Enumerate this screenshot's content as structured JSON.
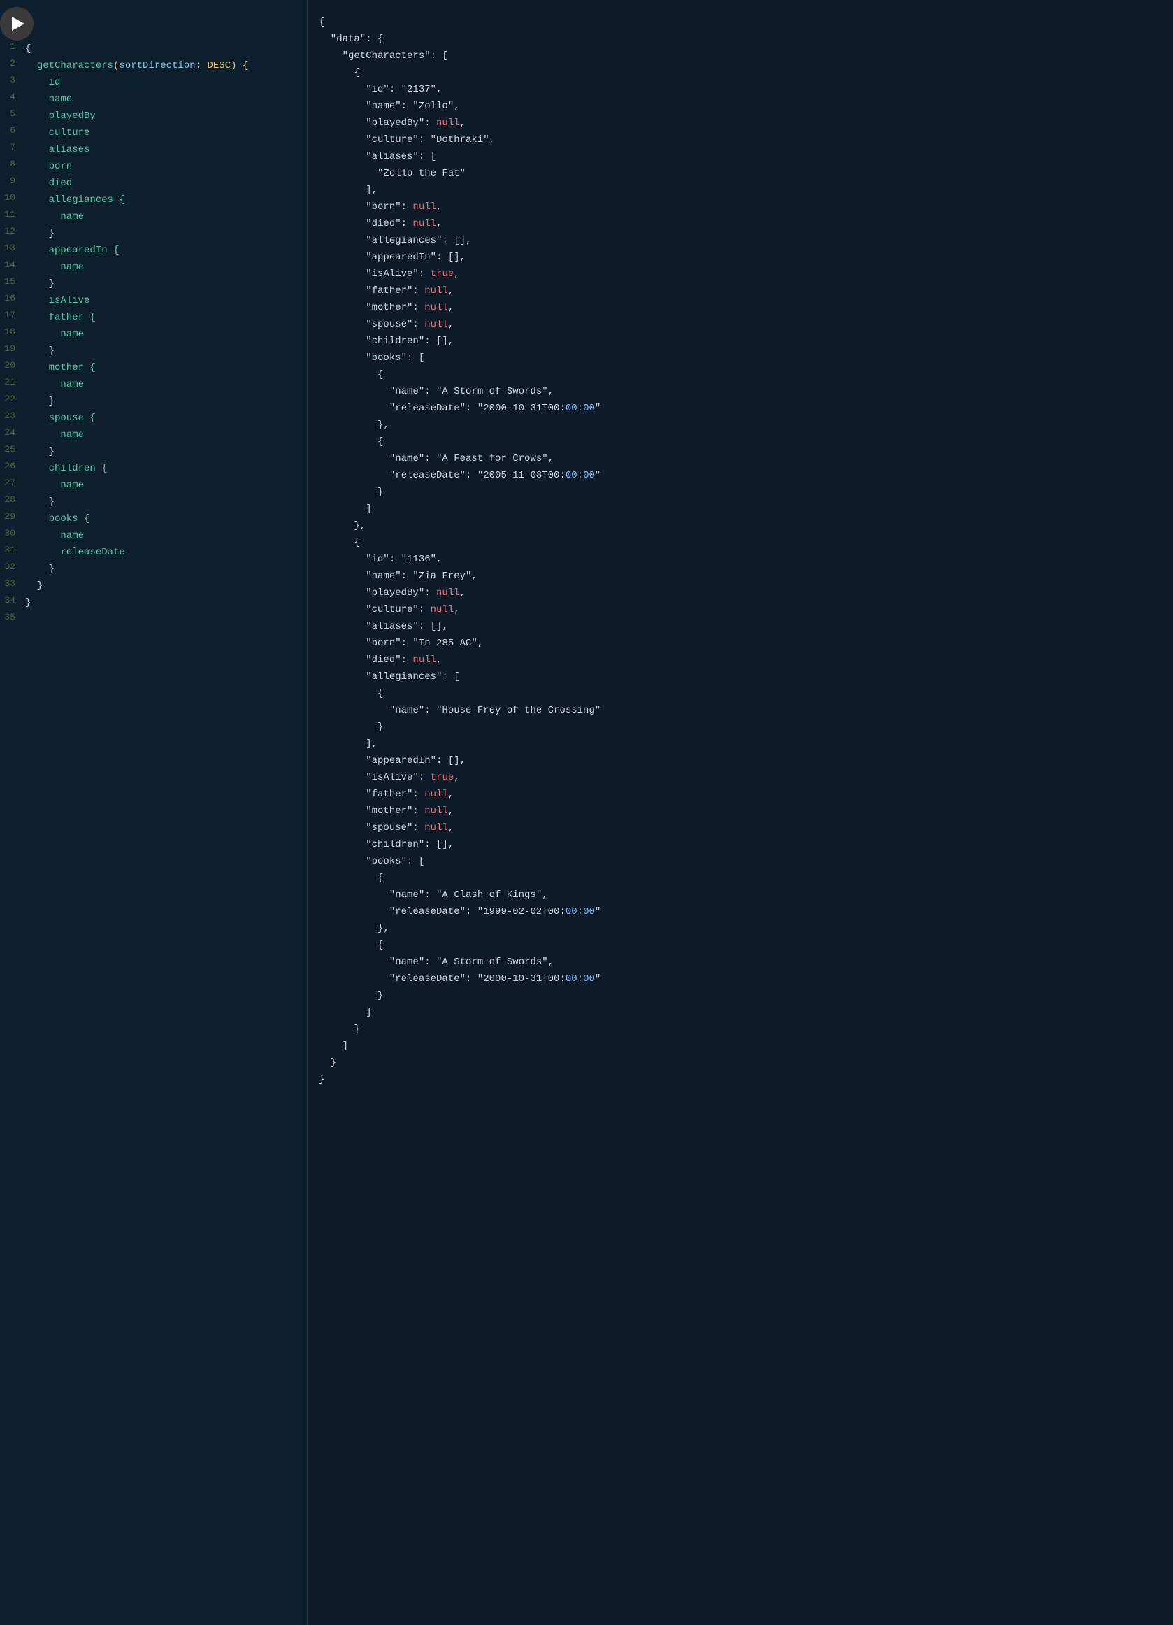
{
  "left_pane": {
    "lines": [
      {
        "num": 1,
        "content": [
          {
            "t": "{",
            "c": "kw-brace"
          }
        ]
      },
      {
        "num": 2,
        "content": [
          {
            "t": "  getCharacters",
            "c": "kw-func"
          },
          {
            "t": "(",
            "c": "kw-paren"
          },
          {
            "t": "sortDirection",
            "c": "kw-arg"
          },
          {
            "t": ": ",
            "c": "kw-colon"
          },
          {
            "t": "DESC",
            "c": "kw-dir"
          },
          {
            "t": ") {",
            "c": "kw-paren"
          }
        ]
      },
      {
        "num": 3,
        "content": [
          {
            "t": "    id",
            "c": "kw-field"
          }
        ]
      },
      {
        "num": 4,
        "content": [
          {
            "t": "    name",
            "c": "kw-field"
          }
        ]
      },
      {
        "num": 5,
        "content": [
          {
            "t": "    playedBy",
            "c": "kw-field"
          }
        ]
      },
      {
        "num": 6,
        "content": [
          {
            "t": "    culture",
            "c": "kw-field"
          }
        ]
      },
      {
        "num": 7,
        "content": [
          {
            "t": "    aliases",
            "c": "kw-field"
          }
        ]
      },
      {
        "num": 8,
        "content": [
          {
            "t": "    born",
            "c": "kw-field"
          }
        ]
      },
      {
        "num": 9,
        "content": [
          {
            "t": "    died",
            "c": "kw-field"
          }
        ]
      },
      {
        "num": 10,
        "content": [
          {
            "t": "    allegiances {",
            "c": "kw-field"
          }
        ]
      },
      {
        "num": 11,
        "content": [
          {
            "t": "      name",
            "c": "kw-field"
          }
        ]
      },
      {
        "num": 12,
        "content": [
          {
            "t": "    }",
            "c": "kw-brace"
          }
        ]
      },
      {
        "num": 13,
        "content": [
          {
            "t": "    appearedIn {",
            "c": "kw-field"
          }
        ]
      },
      {
        "num": 14,
        "content": [
          {
            "t": "      name",
            "c": "kw-field"
          }
        ]
      },
      {
        "num": 15,
        "content": [
          {
            "t": "    }",
            "c": "kw-brace"
          }
        ]
      },
      {
        "num": 16,
        "content": [
          {
            "t": "    isAlive",
            "c": "kw-field"
          }
        ]
      },
      {
        "num": 17,
        "content": [
          {
            "t": "    father {",
            "c": "kw-field"
          }
        ]
      },
      {
        "num": 18,
        "content": [
          {
            "t": "      name",
            "c": "kw-field"
          }
        ]
      },
      {
        "num": 19,
        "content": [
          {
            "t": "    }",
            "c": "kw-brace"
          }
        ]
      },
      {
        "num": 20,
        "content": [
          {
            "t": "    mother {",
            "c": "kw-field"
          }
        ]
      },
      {
        "num": 21,
        "content": [
          {
            "t": "      name",
            "c": "kw-field"
          }
        ]
      },
      {
        "num": 22,
        "content": [
          {
            "t": "    }",
            "c": "kw-brace"
          }
        ]
      },
      {
        "num": 23,
        "content": [
          {
            "t": "    spouse {",
            "c": "kw-field"
          }
        ]
      },
      {
        "num": 24,
        "content": [
          {
            "t": "      name",
            "c": "kw-field"
          }
        ]
      },
      {
        "num": 25,
        "content": [
          {
            "t": "    }",
            "c": "kw-brace"
          }
        ]
      },
      {
        "num": 26,
        "content": [
          {
            "t": "    children {",
            "c": "kw-field"
          }
        ]
      },
      {
        "num": 27,
        "content": [
          {
            "t": "      name",
            "c": "kw-field"
          }
        ]
      },
      {
        "num": 28,
        "content": [
          {
            "t": "    }",
            "c": "kw-brace"
          }
        ]
      },
      {
        "num": 29,
        "content": [
          {
            "t": "    books {",
            "c": "kw-field"
          }
        ]
      },
      {
        "num": 30,
        "content": [
          {
            "t": "      name",
            "c": "kw-field"
          }
        ]
      },
      {
        "num": 31,
        "content": [
          {
            "t": "      releaseDate",
            "c": "kw-field"
          }
        ]
      },
      {
        "num": 32,
        "content": [
          {
            "t": "    }",
            "c": "kw-brace"
          }
        ]
      },
      {
        "num": 33,
        "content": [
          {
            "t": "  }",
            "c": "kw-brace"
          }
        ]
      },
      {
        "num": 34,
        "content": [
          {
            "t": "}",
            "c": "kw-brace"
          }
        ]
      },
      {
        "num": 35,
        "content": []
      }
    ]
  },
  "right_pane": {
    "content": "{\n  \"data\": {\n    \"getCharacters\": [\n      {\n        \"id\": \"2137\",\n        \"name\": \"Zollo\",\n        \"playedBy\": null,\n        \"culture\": \"Dothraki\",\n        \"aliases\": [\n          \"Zollo the Fat\"\n        ],\n        \"born\": null,\n        \"died\": null,\n        \"allegiances\": [],\n        \"appearedIn\": [],\n        \"isAlive\": true,\n        \"father\": null,\n        \"mother\": null,\n        \"spouse\": null,\n        \"children\": [],\n        \"books\": [\n          {\n            \"name\": \"A Storm of Swords\",\n            \"releaseDate\": \"2000-10-31T00:00:00\"\n          },\n          {\n            \"name\": \"A Feast for Crows\",\n            \"releaseDate\": \"2005-11-08T00:00:00\"\n          }\n        ]\n      },\n      {\n        \"id\": \"1136\",\n        \"name\": \"Zia Frey\",\n        \"playedBy\": null,\n        \"culture\": null,\n        \"aliases\": [],\n        \"born\": \"In 285 AC\",\n        \"died\": null,\n        \"allegiances\": [\n          {\n            \"name\": \"House Frey of the Crossing\"\n          }\n        ],\n        \"appearedIn\": [],\n        \"isAlive\": true,\n        \"father\": null,\n        \"mother\": null,\n        \"spouse\": null,\n        \"children\": [],\n        \"books\": [\n          {\n            \"name\": \"A Clash of Kings\",\n            \"releaseDate\": \"1999-02-02T00:00:00\"\n          },\n          {\n            \"name\": \"A Storm of Swords\",\n            \"releaseDate\": \"2000-10-31T00:00:00\"\n          }\n        ]\n      }\n    ]\n  }\n}"
  }
}
